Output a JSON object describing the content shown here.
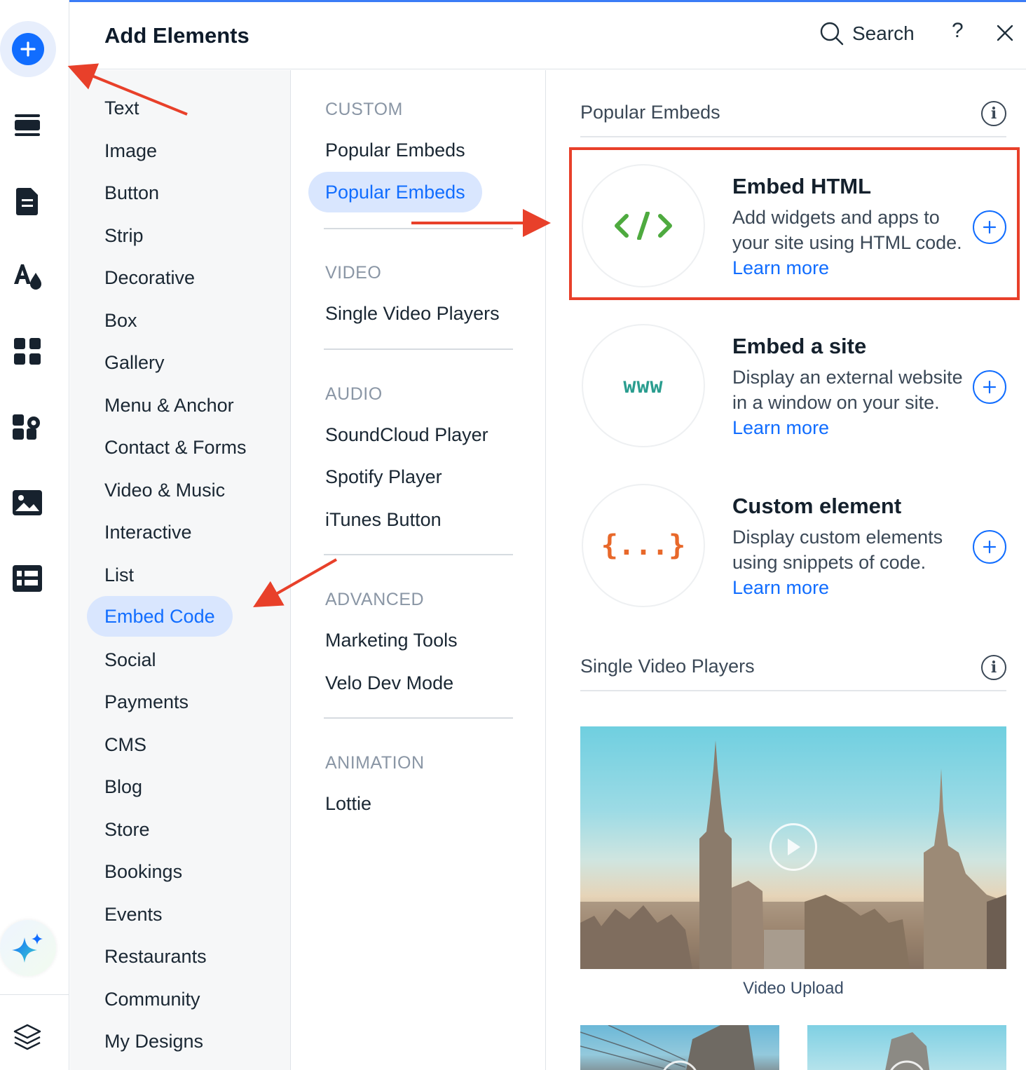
{
  "header": {
    "title": "Add Elements",
    "search_label": "Search",
    "help_label": "?"
  },
  "categories": [
    "Text",
    "Image",
    "Button",
    "Strip",
    "Decorative",
    "Box",
    "Gallery",
    "Menu & Anchor",
    "Contact & Forms",
    "Video & Music",
    "Interactive",
    "List",
    "Embed Code",
    "Social",
    "Payments",
    "CMS",
    "Blog",
    "Store",
    "Bookings",
    "Events",
    "Restaurants",
    "Community",
    "My Designs"
  ],
  "active_category": "Embed Code",
  "subsections": {
    "custom": {
      "label": "CUSTOM",
      "items": [
        "Popular Embeds",
        "Popular Embeds"
      ]
    },
    "video": {
      "label": "VIDEO",
      "items": [
        "Single Video Players"
      ]
    },
    "audio": {
      "label": "AUDIO",
      "items": [
        "SoundCloud Player",
        "Spotify Player",
        "iTunes Button"
      ]
    },
    "advanced": {
      "label": "ADVANCED",
      "items": [
        "Marketing Tools",
        "Velo Dev Mode"
      ]
    },
    "animation": {
      "label": "ANIMATION",
      "items": [
        "Lottie"
      ]
    }
  },
  "popular_embeds": {
    "heading": "Popular Embeds",
    "cards": [
      {
        "icon": "code-brackets-icon",
        "icon_text": "</>",
        "title": "Embed HTML",
        "desc": "Add widgets and apps to your site using HTML code.",
        "link": "Learn more"
      },
      {
        "icon": "www-icon",
        "icon_text": "www",
        "title": "Embed a site",
        "desc": "Display an external website in a window on your site.",
        "link": "Learn more"
      },
      {
        "icon": "curly-braces-icon",
        "icon_text": "{...}",
        "title": "Custom element",
        "desc": "Display custom elements using snippets of code.",
        "link": "Learn more"
      }
    ]
  },
  "video_players": {
    "heading": "Single Video Players",
    "caption": "Video Upload"
  },
  "colors": {
    "accent": "#116dff",
    "active_bg": "#d9e6fe",
    "annotation_red": "#e8402a",
    "html_icon": "#4eaa3f",
    "www_icon": "#2a9d8f",
    "custom_icon": "#e8682a"
  }
}
